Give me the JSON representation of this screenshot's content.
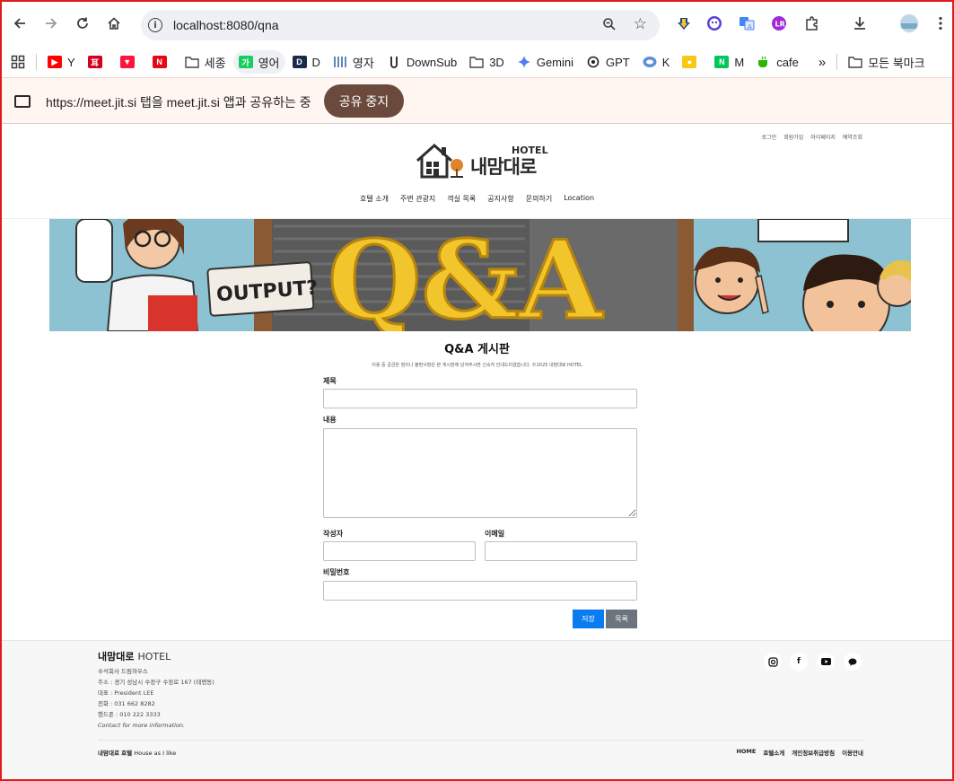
{
  "browser": {
    "url": "localhost:8080/qna"
  },
  "bookmarks": [
    {
      "label": "Y",
      "icon": "youtube-icon",
      "color": "#ff0000"
    },
    {
      "label": "",
      "icon": "bookmark-red-icon",
      "color": "#d6001c"
    },
    {
      "label": "",
      "icon": "tving-icon",
      "color": "#ff153c"
    },
    {
      "label": "",
      "icon": "netflix-icon",
      "color": "#e50914"
    },
    {
      "label": "세종",
      "icon": "folder-icon",
      "color": "#444444"
    },
    {
      "label": "영어",
      "icon": "naver-dict-icon",
      "color": "#19ce60"
    },
    {
      "label": "D",
      "icon": "d-icon",
      "color": "#1a2b4a"
    },
    {
      "label": "영자",
      "icon": "columns-icon",
      "color": "#2a5fa5"
    },
    {
      "label": "DownSub",
      "icon": "downsub-icon",
      "color": "#333333"
    },
    {
      "label": "3D",
      "icon": "folder-icon",
      "color": "#444444"
    },
    {
      "label": "Gemini",
      "icon": "gemini-icon",
      "color": "#4e7cf6"
    },
    {
      "label": "GPT",
      "icon": "openai-icon",
      "color": "#222222"
    },
    {
      "label": "K",
      "icon": "k-icon",
      "color": "#5d8fd8"
    },
    {
      "label": "",
      "icon": "kakao-icon",
      "color": "#f6c915"
    },
    {
      "label": "M",
      "icon": "naver-icon",
      "color": "#03c75a"
    },
    {
      "label": "cafe",
      "icon": "cafe-icon",
      "color": "#2db400"
    }
  ],
  "bookmarks_more": "»",
  "bookmarks_all": "모든 북마크",
  "sharebar": {
    "text": "https://meet.jit.si 탭을 meet.jit.si 앱과 공유하는 중",
    "stop": "공유 중지"
  },
  "site": {
    "top_links": [
      "로그인",
      "회원가입",
      "마이페이지",
      "예약조회"
    ],
    "brand": "내맘대로",
    "brand_hotel": "HOTEL",
    "nav": [
      "호텔 소개",
      "주변 관광지",
      "객실 목록",
      "공지사항",
      "문의하기",
      "Location"
    ],
    "banner": {
      "sign": "OUTPUT?",
      "headline": "Q&A"
    },
    "qna": {
      "title": "Q&A 게시판",
      "subtitle": "이용 중 궁금한 점이나 불편사항은 본 게시판에 남겨주시면 신속히 안내드리겠습니다. ©2025 내맘대로 HOTEL"
    },
    "form": {
      "title_label": "제목",
      "content_label": "내용",
      "author_label": "작성자",
      "email_label": "이메일",
      "password_label": "비밀번호",
      "save": "저장",
      "list": "목록"
    },
    "footer": {
      "brand": "내맘대로",
      "brand_suffix": "HOTEL",
      "lines": [
        "수석회사 드림하우스",
        "주소 : 경기 성남시 수정구 수정로 167 (태평동)",
        "대표 : President LEE",
        "전화 : 031 662 8282",
        "핸드폰 : 010 222 3333"
      ],
      "contact": "Contact for more information.",
      "copy_brand": "내맘대로 호텔",
      "copy_tag": "House as I like",
      "links": [
        "HOME",
        "호텔소개",
        "개인정보취급방침",
        "이용안내"
      ],
      "social": [
        "instagram-icon",
        "facebook-icon",
        "youtube-icon",
        "chat-icon"
      ]
    }
  }
}
